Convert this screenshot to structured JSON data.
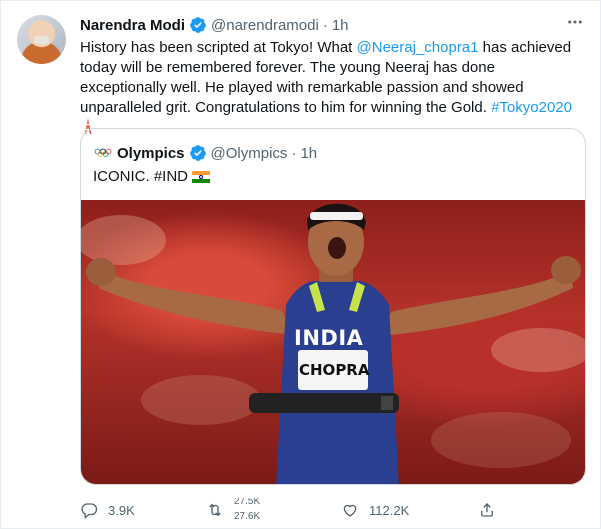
{
  "tweet": {
    "author_name": "Narendra Modi",
    "author_handle": "@narendramodi",
    "separator": "·",
    "time": "1h",
    "text_part1": "History has been scripted at Tokyo! What ",
    "mention": "@Neeraj_chopra1",
    "text_part2": " has achieved today will be remembered forever. The young Neeraj has done exceptionally well. He played with remarkable passion and showed unparalleled grit. Congratulations to him for winning the Gold. ",
    "hashtag": "#Tokyo2020",
    "more_icon": "more-horizontal-icon"
  },
  "quote": {
    "author_name": "Olympics",
    "author_handle": "@Olympics",
    "separator": "·",
    "time": "1h",
    "text": "ICONIC. #IND",
    "photo": {
      "vest_text": "INDIA",
      "bib_text": "CHOPRA"
    }
  },
  "actions": {
    "reply_count": "3.9K",
    "retweet_count_top": "27.5K",
    "retweet_count_bottom": "27.6K",
    "like_count": "112.2K"
  },
  "colors": {
    "link": "#1d9bf0",
    "muted": "#536471",
    "border": "#cfd9de",
    "verified": "#1d9bf0"
  }
}
